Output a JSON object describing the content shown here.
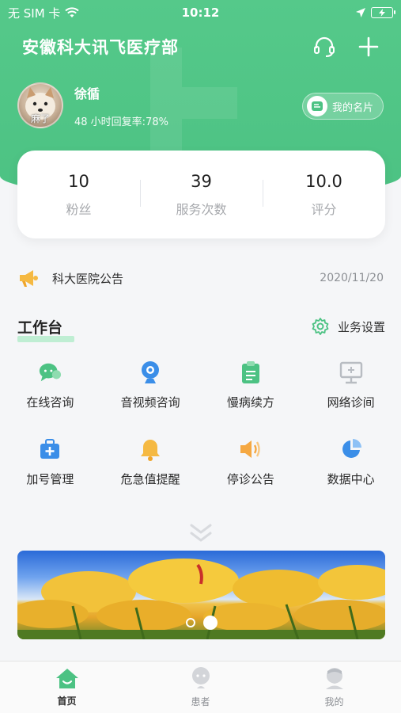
{
  "status_bar": {
    "carrier": "无 SIM 卡",
    "time": "10:12"
  },
  "header": {
    "title": "安徽科大讯飞医疗部"
  },
  "profile": {
    "name": "徐循",
    "reply_stat": "48 小时回复率:78%",
    "avatar_caption": "麻了",
    "card_button": "我的名片"
  },
  "stats": [
    {
      "value": "10",
      "label": "粉丝"
    },
    {
      "value": "39",
      "label": "服务次数"
    },
    {
      "value": "10.0",
      "label": "评分"
    }
  ],
  "announcement": {
    "text": "科大医院公告",
    "date": "2020/11/20"
  },
  "workbench": {
    "title": "工作台",
    "settings_label": "业务设置",
    "items": [
      {
        "label": "在线咨询",
        "icon": "chat-bubble-icon",
        "color": "#4cc283"
      },
      {
        "label": "音视频咨询",
        "icon": "video-camera-icon",
        "color": "#3b8ee8"
      },
      {
        "label": "慢病续方",
        "icon": "prescription-icon",
        "color": "#4cc283"
      },
      {
        "label": "网络诊间",
        "icon": "monitor-icon",
        "color": "#b8bcc2"
      },
      {
        "label": "加号管理",
        "icon": "medical-kit-icon",
        "color": "#3b8ee8"
      },
      {
        "label": "危急值提醒",
        "icon": "bell-icon",
        "color": "#f5b942"
      },
      {
        "label": "停诊公告",
        "icon": "speaker-icon",
        "color": "#f5a842"
      },
      {
        "label": "数据中心",
        "icon": "pie-chart-icon",
        "color": "#3b8ee8"
      }
    ]
  },
  "banner": {
    "slides": 2,
    "active_slide": 2
  },
  "tabbar": [
    {
      "label": "首页",
      "icon": "home-icon",
      "active": true
    },
    {
      "label": "患者",
      "icon": "patient-icon",
      "active": false
    },
    {
      "label": "我的",
      "icon": "profile-icon",
      "active": false
    }
  ],
  "colors": {
    "brand": "#4cc283"
  }
}
